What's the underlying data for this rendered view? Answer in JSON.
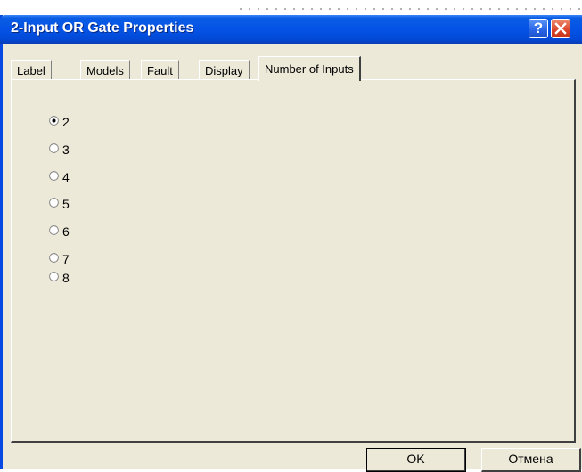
{
  "window": {
    "title": "2-Input OR Gate Properties"
  },
  "titlebar_buttons": {
    "help": "?",
    "close": "×"
  },
  "tabs": [
    {
      "label": "Label"
    },
    {
      "label": "Models"
    },
    {
      "label": "Fault"
    },
    {
      "label": "Display"
    },
    {
      "label": "Number of Inputs",
      "active": true
    }
  ],
  "inputs": {
    "selected": "2",
    "options": [
      "2",
      "3",
      "4",
      "5",
      "6",
      "7",
      "8"
    ]
  },
  "buttons": {
    "ok": "OK",
    "cancel": "Отмена"
  },
  "colors": {
    "title_bar": "#0453e6",
    "dialog_bg": "#ece9d8",
    "close_red": "#d9442a"
  }
}
